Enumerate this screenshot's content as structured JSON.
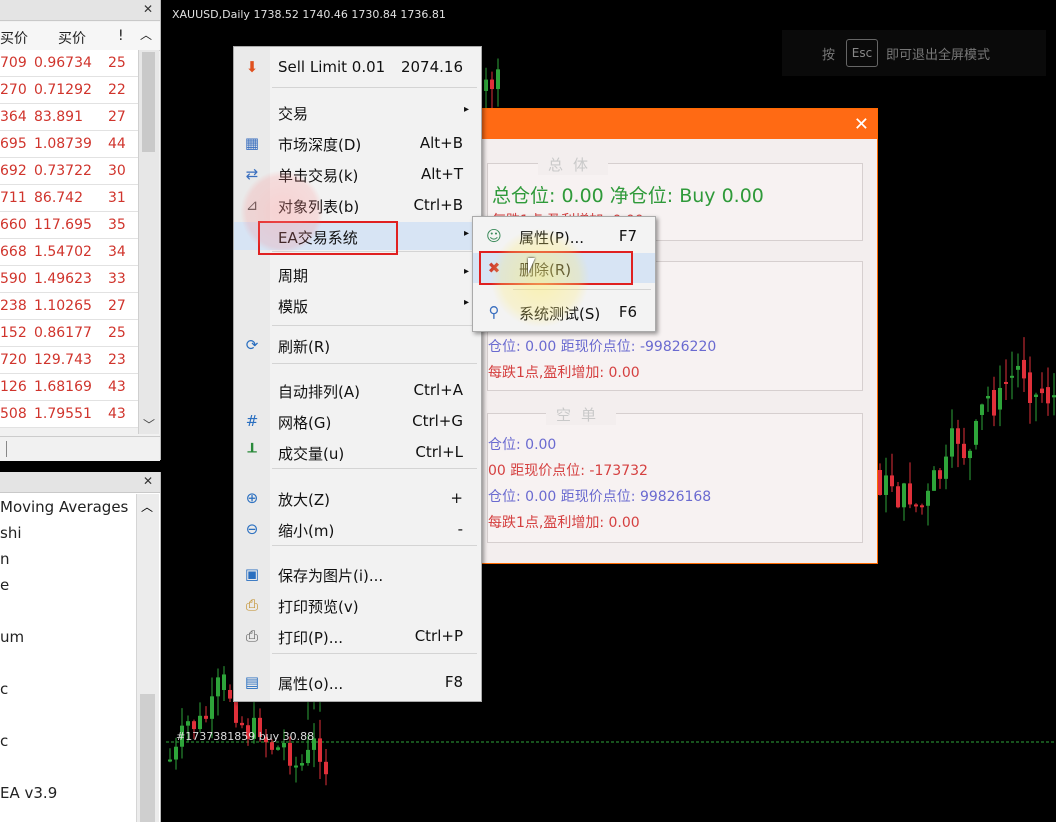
{
  "market_watch": {
    "close_glyph": "✕",
    "col_bid": "买价",
    "col_ask": "买价",
    "col_spread": "!",
    "rows": [
      {
        "bid": "709",
        "ask": "0.96734",
        "spread": "25"
      },
      {
        "bid": "270",
        "ask": "0.71292",
        "spread": "22"
      },
      {
        "bid": "364",
        "ask": "83.891",
        "spread": "27"
      },
      {
        "bid": "695",
        "ask": "1.08739",
        "spread": "44"
      },
      {
        "bid": "692",
        "ask": "0.73722",
        "spread": "30"
      },
      {
        "bid": "711",
        "ask": "86.742",
        "spread": "31"
      },
      {
        "bid": "660",
        "ask": "117.695",
        "spread": "35"
      },
      {
        "bid": "668",
        "ask": "1.54702",
        "spread": "34"
      },
      {
        "bid": "590",
        "ask": "1.49623",
        "spread": "33"
      },
      {
        "bid": "238",
        "ask": "1.10265",
        "spread": "27"
      },
      {
        "bid": "152",
        "ask": "0.86177",
        "spread": "25"
      },
      {
        "bid": "720",
        "ask": "129.743",
        "spread": "23"
      },
      {
        "bid": "126",
        "ask": "1.68169",
        "spread": "43"
      },
      {
        "bid": "508",
        "ask": "1.79551",
        "spread": "43"
      }
    ]
  },
  "navigator": {
    "close_glyph": "✕",
    "items": [
      "Moving Averages",
      "shi",
      "n",
      "e",
      "",
      "um",
      "",
      "c",
      "",
      "c",
      "",
      "EA v3.9"
    ]
  },
  "chart": {
    "title": "XAUUSD,Daily  1738.52 1740.46 1730.84 1736.81",
    "esc_hint": {
      "before": "按",
      "key": "Esc",
      "after": "即可退出全屏模式"
    },
    "line_label": "#1737381859 buy 30.88",
    "colors": {
      "bull": "#2ea53a",
      "bear": "#e0303a"
    }
  },
  "ea_dialog": {
    "close_glyph": "✕",
    "total": {
      "title": "总体",
      "line1": "总仓位: 0.00  净仓位: Buy 0.00",
      "line2": "每跌1点,盈利增加: 0.00"
    },
    "long": {
      "line1": "仓位: 0.00   距现价点位: -99826220",
      "line2": "每跌1点,盈利增加: 0.00"
    },
    "short": {
      "title": "空单",
      "line1": "仓位: 0.00",
      "line2": "00   距现价点位: -173732",
      "line3": "仓位: 0.00   距现价点位: 99826168",
      "line4": "每跌1点,盈利增加: 0.00"
    }
  },
  "context_menu": {
    "items": [
      {
        "label": "Sell Limit 0.01",
        "shortcut": "2074.16",
        "icon": "sell-limit-icon"
      },
      {
        "label": "交易",
        "shortcut": "",
        "submenu": true
      },
      {
        "label": "市场深度(D)",
        "shortcut": "Alt+B",
        "icon": "market-depth-icon"
      },
      {
        "label": "单击交易(k)",
        "shortcut": "Alt+T",
        "icon": "one-click-icon"
      },
      {
        "label": "对象列表(b)",
        "shortcut": "Ctrl+B",
        "icon": "object-list-icon"
      },
      {
        "label": "EA交易系统",
        "shortcut": "",
        "submenu": true
      },
      {
        "label": "周期",
        "shortcut": "",
        "submenu": true
      },
      {
        "label": "模版",
        "shortcut": "",
        "submenu": true
      },
      {
        "label": "刷新(R)",
        "shortcut": "",
        "icon": "refresh-icon"
      },
      {
        "label": "自动排列(A)",
        "shortcut": "Ctrl+A"
      },
      {
        "label": "网格(G)",
        "shortcut": "Ctrl+G",
        "icon": "grid-icon"
      },
      {
        "label": "成交量(u)",
        "shortcut": "Ctrl+L",
        "icon": "volume-icon"
      },
      {
        "label": "放大(Z)",
        "shortcut": "+",
        "icon": "zoom-in-icon"
      },
      {
        "label": "缩小(m)",
        "shortcut": "-",
        "icon": "zoom-out-icon"
      },
      {
        "label": "保存为图片(i)...",
        "shortcut": "",
        "icon": "save-picture-icon"
      },
      {
        "label": "打印预览(v)",
        "shortcut": "",
        "icon": "print-preview-icon"
      },
      {
        "label": "打印(P)...",
        "shortcut": "Ctrl+P",
        "icon": "print-icon"
      },
      {
        "label": "属性(o)...",
        "shortcut": "F8",
        "icon": "properties-icon"
      }
    ]
  },
  "submenu": {
    "items": [
      {
        "label": "属性(P)...",
        "shortcut": "F7",
        "icon": "ea-properties-icon"
      },
      {
        "label": "删除(R)",
        "shortcut": "",
        "icon": "ea-remove-icon"
      },
      {
        "label": "系统测试(S)",
        "shortcut": "F6",
        "icon": "strategy-test-icon"
      }
    ]
  }
}
